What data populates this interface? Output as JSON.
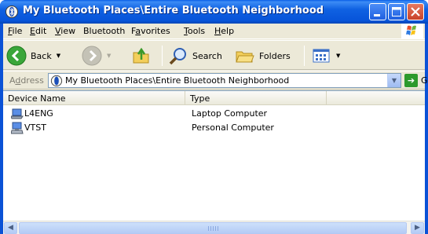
{
  "window": {
    "title": "My Bluetooth Places\\Entire Bluetooth Neighborhood",
    "title_icon": "bluetooth-places-icon",
    "colors": {
      "titlebar": "#0754d9",
      "close": "#c9432a",
      "chrome": "#ece9d8"
    }
  },
  "menubar": {
    "items": [
      {
        "mnemonic": "F",
        "rest": "ile"
      },
      {
        "mnemonic": "E",
        "rest": "dit"
      },
      {
        "mnemonic": "V",
        "rest": "iew"
      },
      {
        "mnemonic": "",
        "rest": "Bluetooth"
      },
      {
        "mnemonic": "a",
        "prefix": "F",
        "rest": "vorites"
      },
      {
        "mnemonic": "T",
        "rest": "ools"
      },
      {
        "mnemonic": "H",
        "rest": "elp"
      }
    ]
  },
  "toolbar": {
    "back_label": "Back",
    "search_label": "Search",
    "folders_label": "Folders"
  },
  "addressbar": {
    "label_prefix": "A",
    "label_mnemonic": "d",
    "label_rest": "dress",
    "value": "My Bluetooth Places\\Entire Bluetooth Neighborhood",
    "go_label": "Go"
  },
  "listview": {
    "columns": [
      "Device Name",
      "Type"
    ],
    "rows": [
      {
        "name": "L4ENG",
        "type": "Laptop Computer",
        "icon": "laptop-computer-icon"
      },
      {
        "name": "VTST",
        "type": "Personal Computer",
        "icon": "personal-computer-icon"
      }
    ]
  }
}
